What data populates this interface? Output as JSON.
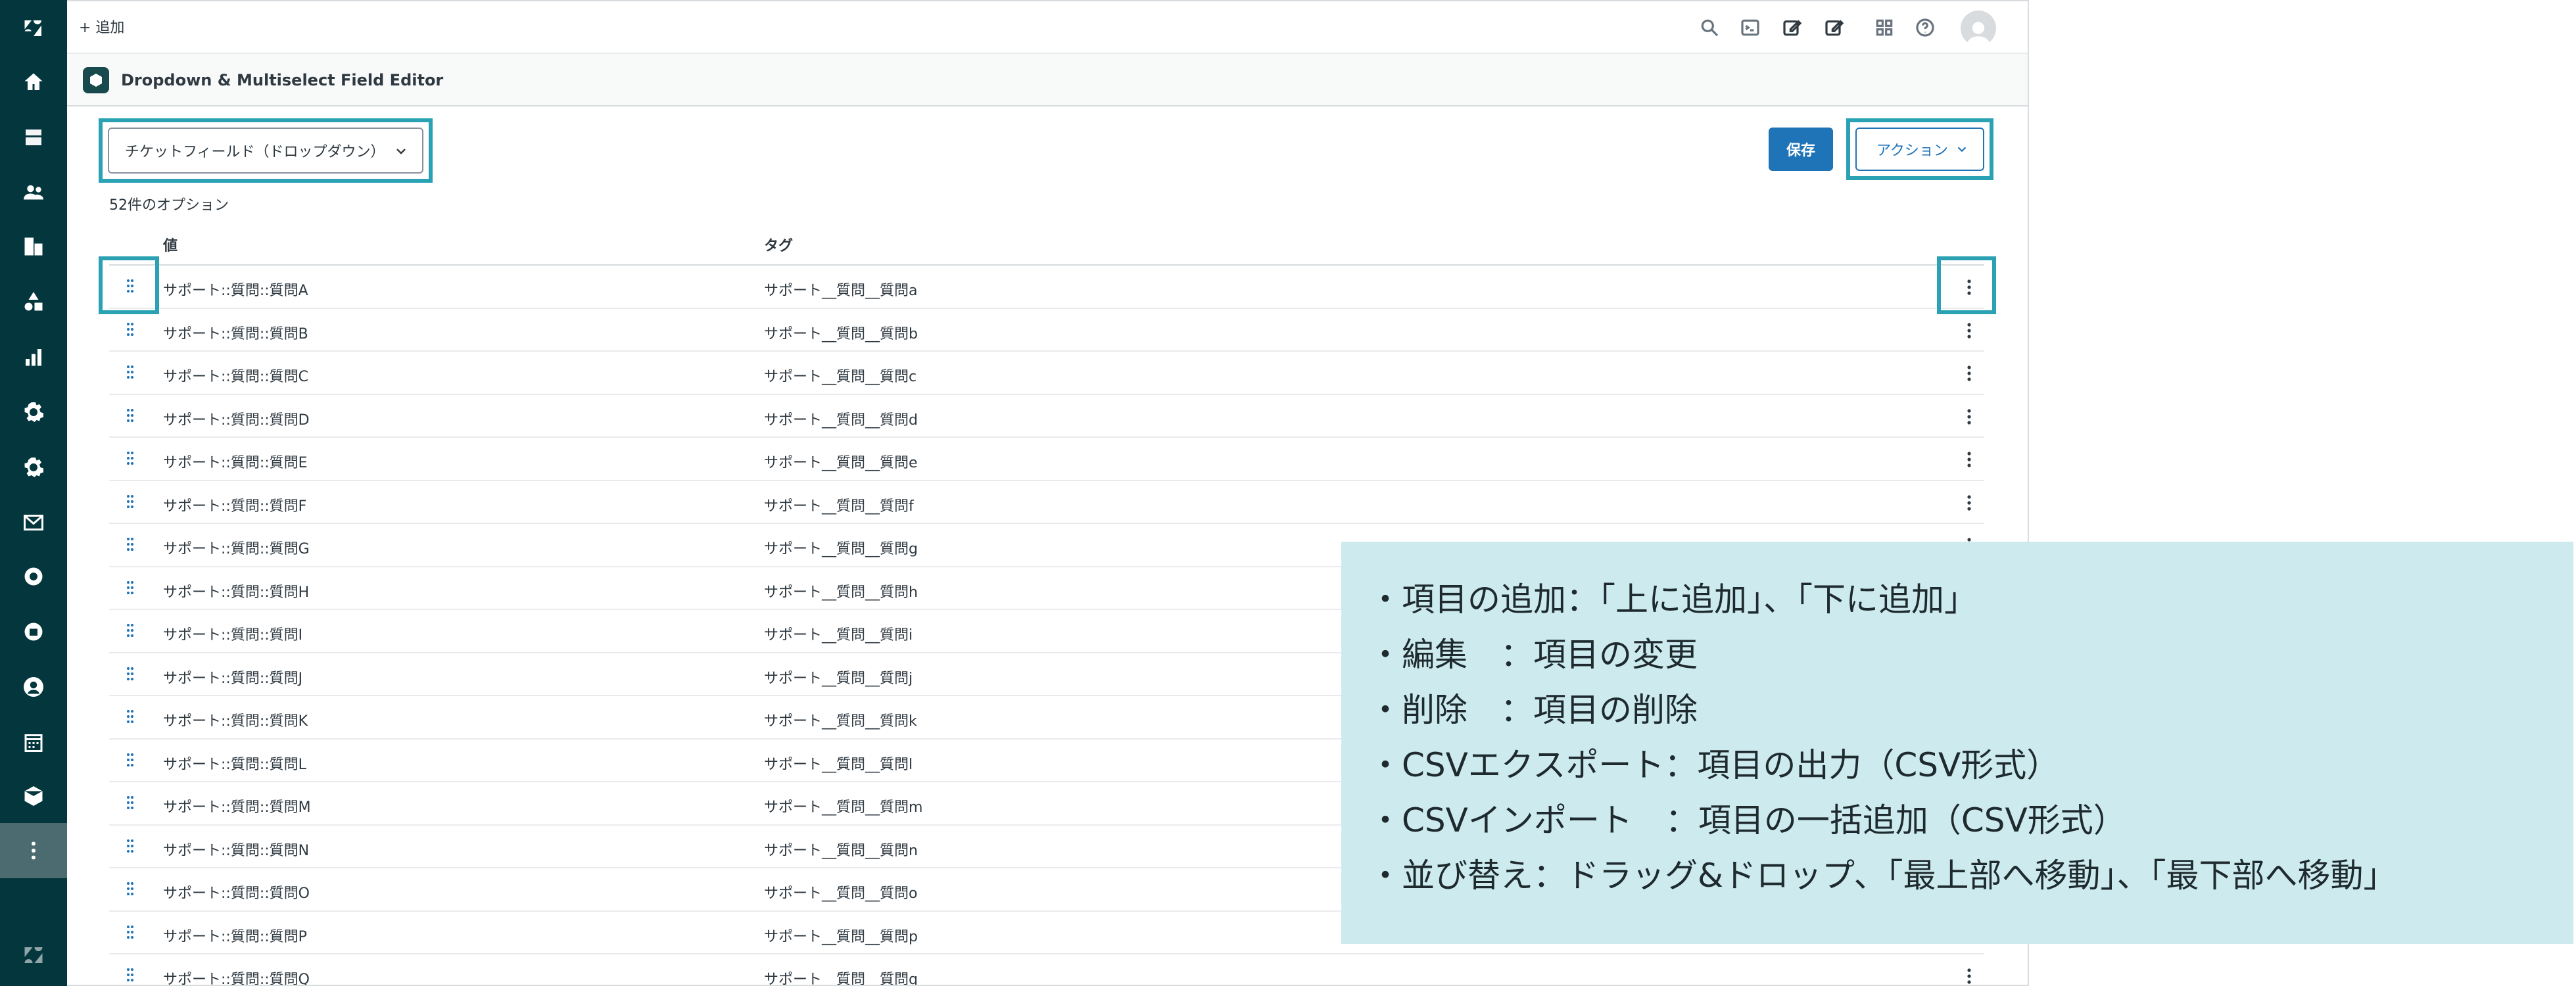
{
  "topbar": {
    "add_label": "+ 追加"
  },
  "app": {
    "title": "Dropdown & Multiselect Field Editor"
  },
  "field_select": {
    "value": "チケットフィールド（ドロップダウン）"
  },
  "buttons": {
    "save_label": "保存",
    "actions_label": "アクション"
  },
  "option_count": "52件のオプション",
  "table": {
    "headers": {
      "value": "値",
      "tag": "タグ"
    },
    "rows": [
      {
        "value": "サポート::質問::質問A",
        "tag": "サポート__質問__質問a"
      },
      {
        "value": "サポート::質問::質問B",
        "tag": "サポート__質問__質問b"
      },
      {
        "value": "サポート::質問::質問C",
        "tag": "サポート__質問__質問c"
      },
      {
        "value": "サポート::質問::質問D",
        "tag": "サポート__質問__質問d"
      },
      {
        "value": "サポート::質問::質問E",
        "tag": "サポート__質問__質問e"
      },
      {
        "value": "サポート::質問::質問F",
        "tag": "サポート__質問__質問f"
      },
      {
        "value": "サポート::質問::質問G",
        "tag": "サポート__質問__質問g"
      },
      {
        "value": "サポート::質問::質問H",
        "tag": "サポート__質問__質問h"
      },
      {
        "value": "サポート::質問::質問I",
        "tag": "サポート__質問__質問i"
      },
      {
        "value": "サポート::質問::質問J",
        "tag": "サポート__質問__質問j"
      },
      {
        "value": "サポート::質問::質問K",
        "tag": "サポート__質問__質問k"
      },
      {
        "value": "サポート::質問::質問L",
        "tag": "サポート__質問__質問l"
      },
      {
        "value": "サポート::質問::質問M",
        "tag": "サポート__質問__質問m"
      },
      {
        "value": "サポート::質問::質問N",
        "tag": "サポート__質問__質問n"
      },
      {
        "value": "サポート::質問::質問O",
        "tag": "サポート__質問__質問o"
      },
      {
        "value": "サポート::質問::質問P",
        "tag": "サポート__質問__質問p"
      },
      {
        "value": "サポート::質問::質問Q",
        "tag": "サポート__質問__質問q"
      }
    ]
  },
  "info_panel": {
    "lines": [
      "・項目の追加：「上に追加」、「下に追加」",
      "・編集　：項目の変更",
      "・削除　：項目の削除",
      "・CSVエクスポート：項目の出力（CSV形式）",
      "・CSVインポート　：項目の一括追加（CSV形式）",
      "・並び替え：ドラッグ&ドロップ、「最上部へ移動」、「最下部へ移動」"
    ]
  },
  "colors": {
    "sidebar": "#03363d",
    "primary": "#1f73b7",
    "highlight": "#2aa2b4",
    "info_bg": "#cdebef"
  }
}
